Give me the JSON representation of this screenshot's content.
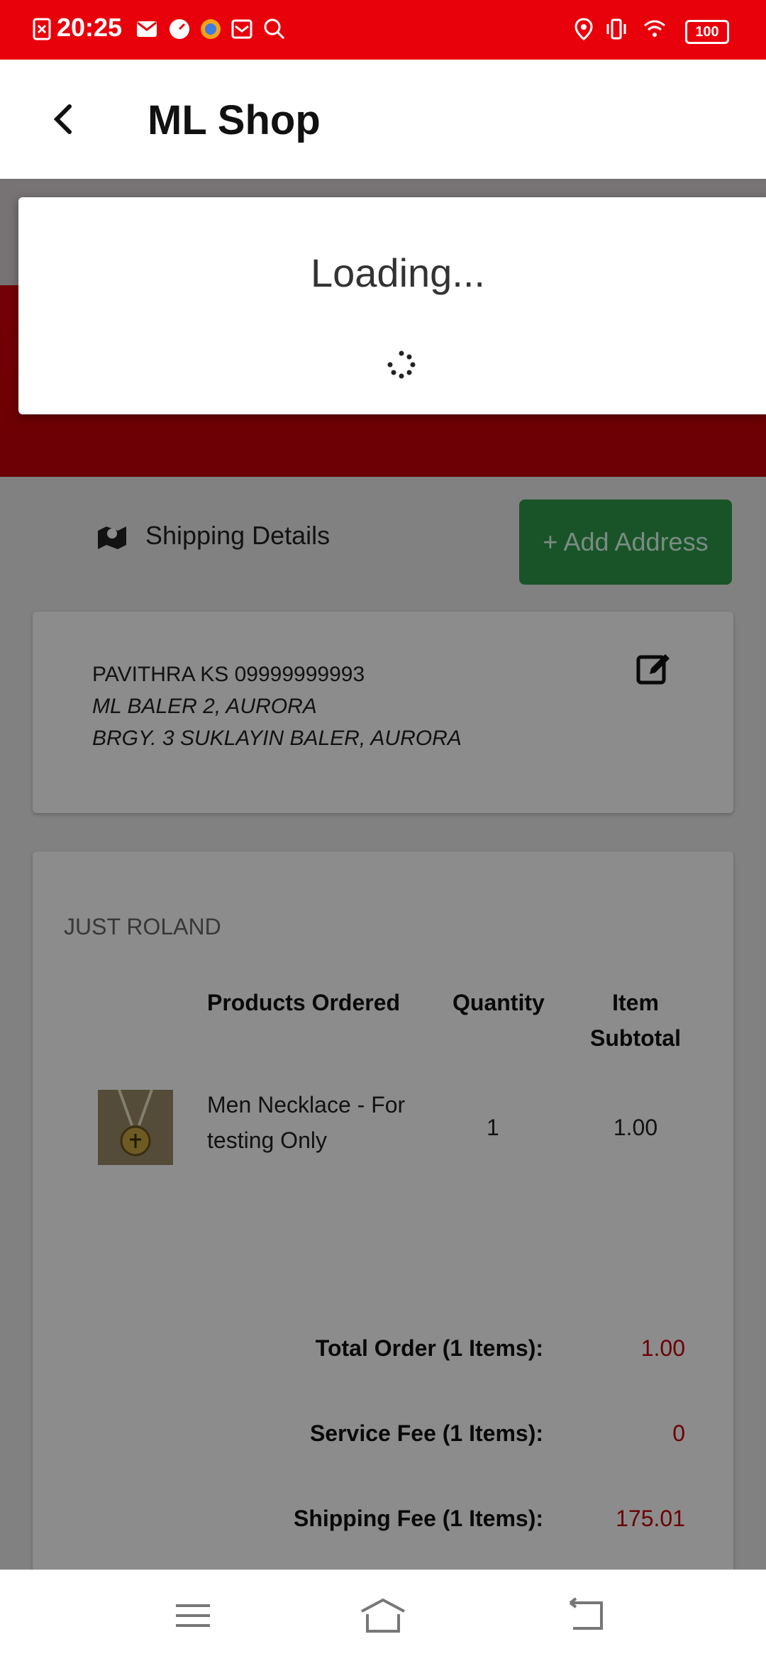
{
  "status_bar": {
    "time": "20:25",
    "battery": "100"
  },
  "header": {
    "title": "ML Shop"
  },
  "shipping": {
    "label": "Shipping Details",
    "add_address_button": "+ Add Address"
  },
  "address": {
    "line1": "PAVITHRA KS 09999999993",
    "line2": "ML BALER 2, AURORA",
    "line3": "BRGY. 3 SUKLAYIN BALER, AURORA"
  },
  "order": {
    "seller": "JUST ROLAND",
    "columns": {
      "product": "Products Ordered",
      "quantity": "Quantity",
      "subtotal_line1": "Item",
      "subtotal_line2": "Subtotal"
    },
    "items": [
      {
        "name": "Men Necklace - For testing Only",
        "quantity": "1",
        "subtotal": "1.00"
      }
    ],
    "summary": [
      {
        "label": "Total Order (1 Items):",
        "value": "1.00"
      },
      {
        "label": "Service Fee (1 Items):",
        "value": "0"
      },
      {
        "label": "Shipping Fee (1 Items):",
        "value": "175.01"
      }
    ]
  },
  "loading": {
    "text": "Loading..."
  },
  "colors": {
    "status_bar": "#e8000b",
    "add_address": "#2e9a4a",
    "price": "#c40008"
  }
}
